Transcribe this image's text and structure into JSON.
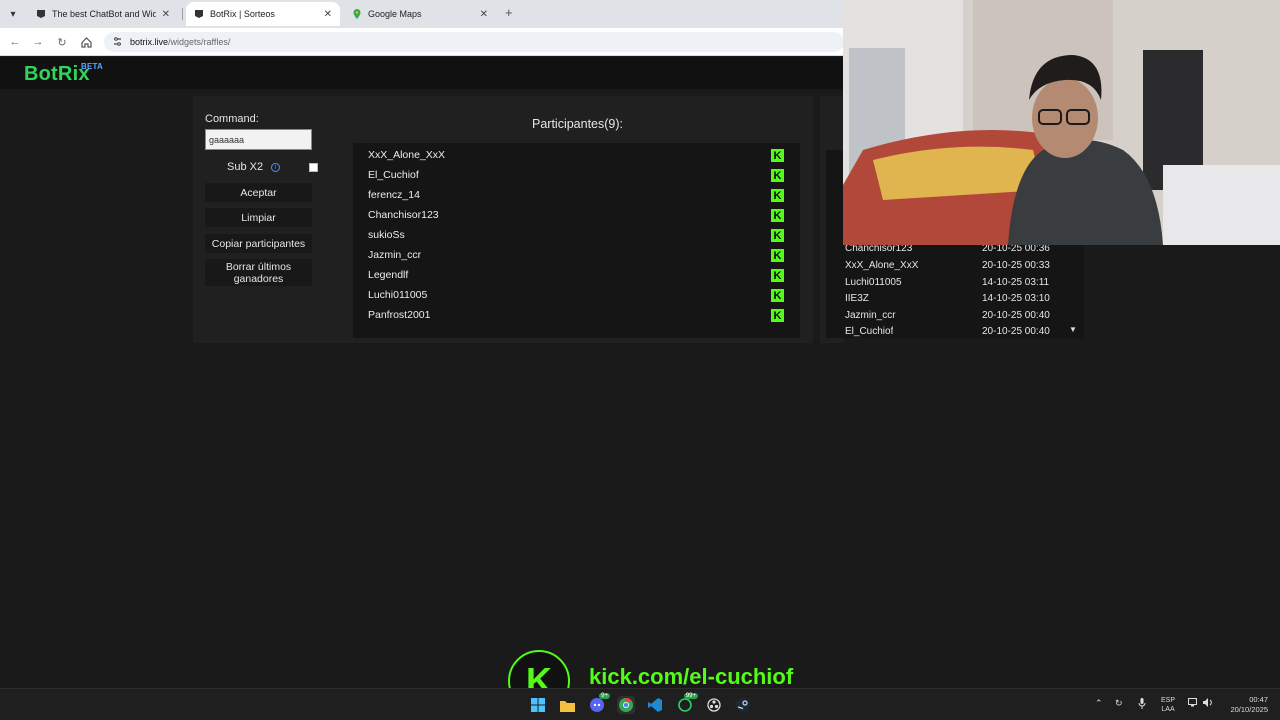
{
  "browser": {
    "tabs": [
      {
        "label": "The best ChatBot and Widgets",
        "active": false
      },
      {
        "label": "BotRix | Sorteos",
        "active": true
      },
      {
        "label": "Google Maps",
        "active": false
      }
    ],
    "address": {
      "host": "botrix.live",
      "path": "/widgets/raffles/"
    }
  },
  "app": {
    "logo": "BotRix",
    "logo_badge": "BETA",
    "command_label": "Command:",
    "command_value": "gaaaaaa",
    "sub_label": "Sub X2",
    "buttons": {
      "accept": "Aceptar",
      "clear": "Limpiar",
      "copy": "Copiar participantes",
      "delete_winners": "Borrar últimos ganadores"
    },
    "participants_title": "Participantes(9):",
    "participants": [
      "XxX_Alone_XxX",
      "El_Cuchiof",
      "ferencz_14",
      "Chanchisor123",
      "sukioSs",
      "Jazmin_ccr",
      "Legendlf",
      "Luchi011005",
      "Panfrost2001"
    ],
    "winners": [
      {
        "name": "Chanchisor123",
        "date": "20-10-25 00:36"
      },
      {
        "name": "XxX_Alone_XxX",
        "date": "20-10-25 00:33"
      },
      {
        "name": "Luchi011005",
        "date": "14-10-25 03:11"
      },
      {
        "name": "IIE3Z",
        "date": "14-10-25 03:10"
      },
      {
        "name": "Jazmin_ccr",
        "date": "20-10-25 00:40"
      },
      {
        "name": "El_Cuchiof",
        "date": "20-10-25 00:40"
      }
    ]
  },
  "overlay": {
    "kick_letter": "K",
    "kick_url": "kick.com/el-cuchiof"
  },
  "taskbar": {
    "lang_top": "ESP",
    "lang_bottom": "LAA",
    "time": "00:47",
    "date": "20/10/2025",
    "discord_badge": "9+",
    "whatsapp_badge": "99+"
  },
  "colors": {
    "kick_green": "#53fc18",
    "botrix_green": "#2fd65a",
    "beta_blue": "#59a6ff"
  }
}
